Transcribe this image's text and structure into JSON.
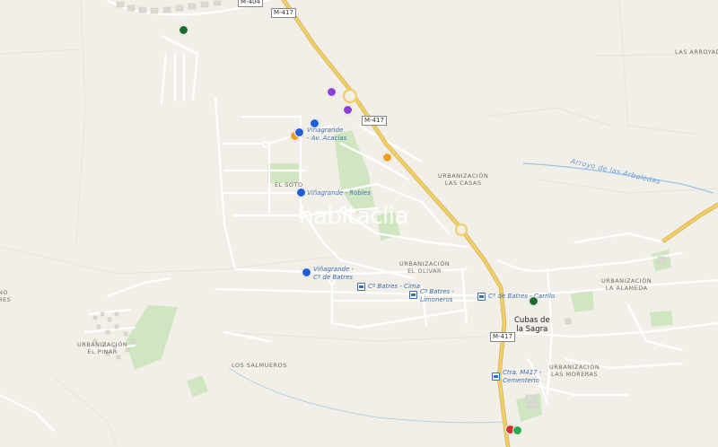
{
  "map": {
    "roads": {
      "m417_a": "M-417",
      "m417_b": "M-417",
      "m417_c": "M-417",
      "m404": "M-404"
    },
    "areas": {
      "las_arroyadas": "LAS ARROYADAS",
      "el_soto": "EL SOTO",
      "urb_las_casas": "URBANIZACIÓN\nLAS CASAS",
      "urb_el_olivar": "URBANIZACIÓN\nEL OLIVAR",
      "urb_la_alameda": "URBANIZACIÓN\nLA ALAMEDA",
      "urb_las_moreras": "URBANIZACIÓN\nLAS MORERAS",
      "urb_el_pinar": "URBANIZACIÓN\nEL PINAR",
      "los_salmueros": "LOS SALMUEROS",
      "edge_left": "NO\nRES"
    },
    "town": "Cubas de\nla Sagra",
    "stream": "Arroyo de las Arboledas",
    "watermark": "habitaclia",
    "bus_stops": {
      "acacias": "Viñagrande\n- Av. Acacias",
      "robles": "Viñagrande - Robles",
      "batres": "Viñagrande -\nCº de Batres",
      "cima": "Cº Batres - Cima",
      "limoneros": "Cº Batres -\nLimoneros",
      "carrilo": "Cº de Batres - Carrilo",
      "cementerio": "Ctra. M417 -\nCementerio"
    },
    "colors": {
      "background": "#f2efe9",
      "highway": "#f0cf6b",
      "highway_border": "#d9b24a",
      "street": "#ffffff",
      "park": "#cfe6c0",
      "water": "#9cc3e8",
      "pin_blue": "#1f5fd6",
      "pin_purple": "#8a3fd6",
      "pin_orange": "#f0a020",
      "pin_dark_green": "#1d6b2e",
      "pin_green": "#2eaa4a",
      "pin_red": "#d62e2e"
    }
  }
}
